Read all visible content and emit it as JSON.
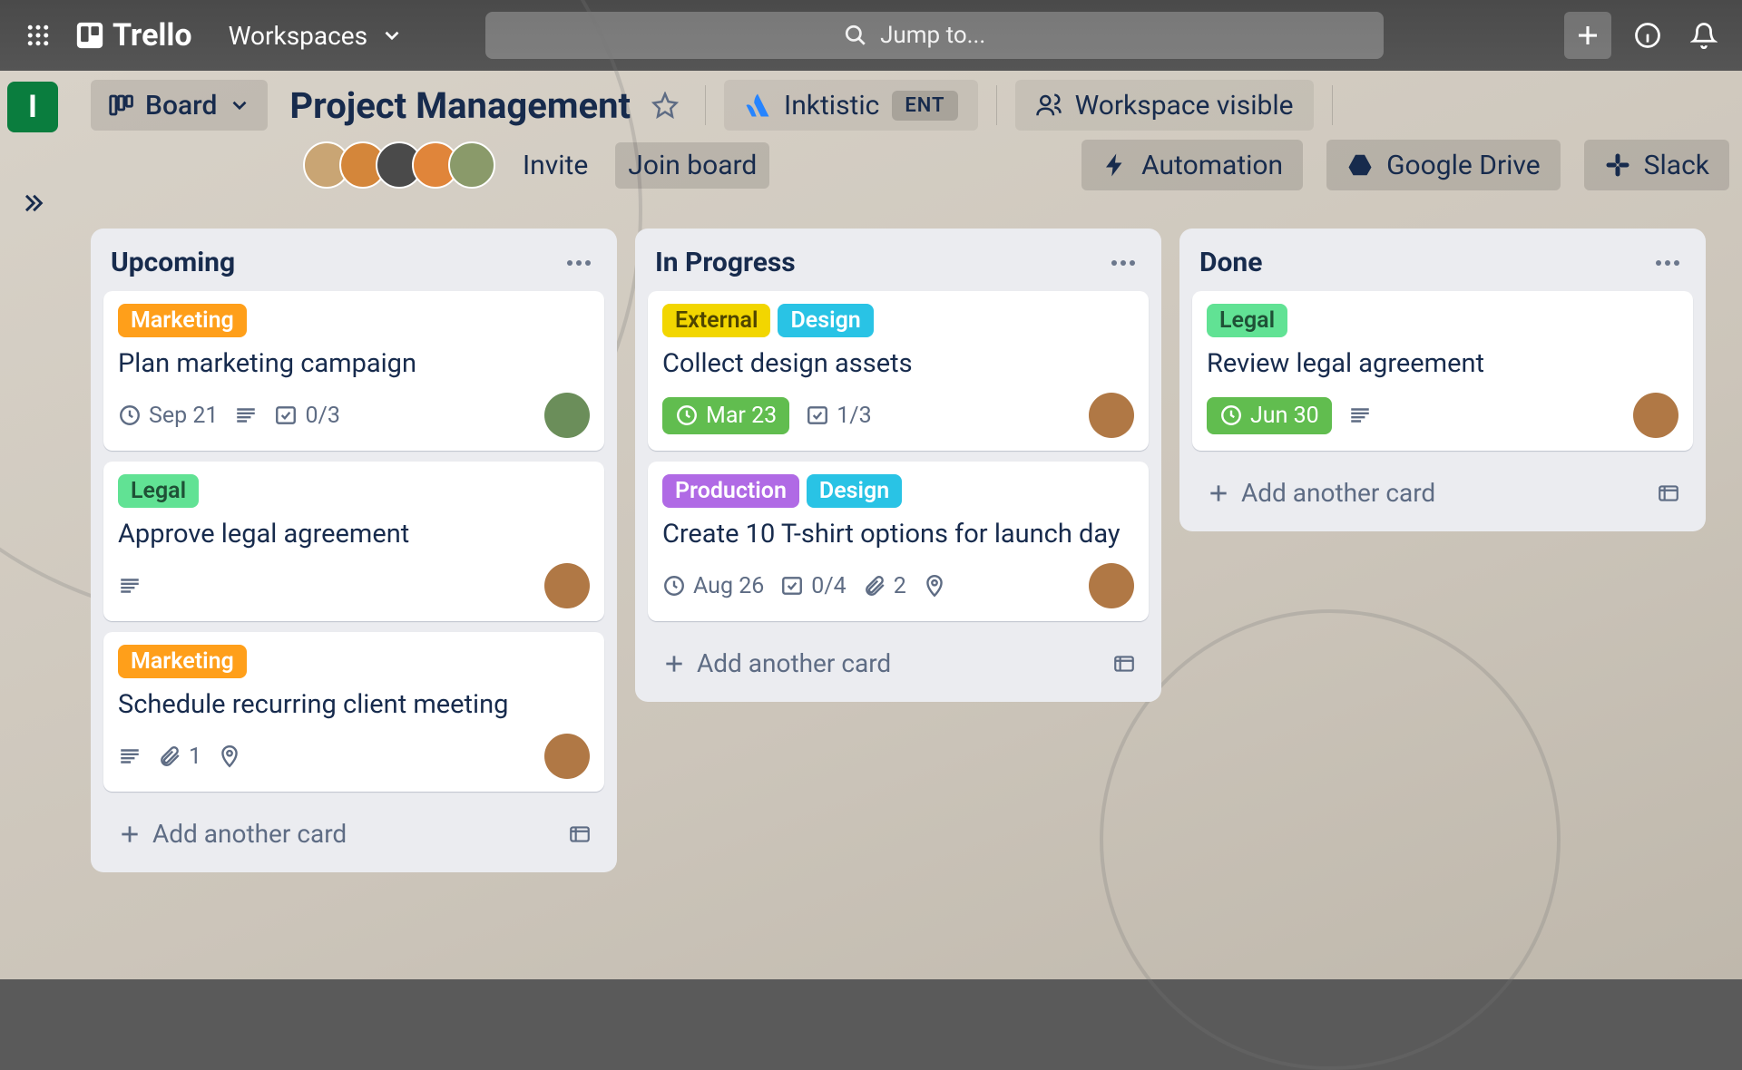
{
  "nav": {
    "brand": "Trello",
    "workspaces": "Workspaces",
    "search_placeholder": "Jump to..."
  },
  "board": {
    "ws_initial": "I",
    "view": "Board",
    "name": "Project Management",
    "org": "Inktistic",
    "org_badge": "ENT",
    "visibility": "Workspace visible",
    "invite": "Invite",
    "join": "Join board",
    "automation": "Automation",
    "gdrive": "Google Drive",
    "slack": "Slack"
  },
  "labels": {
    "marketing": "Marketing",
    "legal": "Legal",
    "external": "External",
    "design": "Design",
    "production": "Production"
  },
  "lists": [
    {
      "title": "Upcoming",
      "add": "Add another card",
      "cards": [
        {
          "labels": [
            "marketing"
          ],
          "title": "Plan marketing campaign",
          "due": "Sep 21",
          "due_color": "",
          "desc": true,
          "check": "0/3",
          "attach": "",
          "loc": false,
          "avatar": "#6b8e5a"
        },
        {
          "labels": [
            "legal"
          ],
          "title": "Approve legal agreement",
          "due": "",
          "due_color": "",
          "desc": true,
          "check": "",
          "attach": "",
          "loc": false,
          "avatar": "#b07845"
        },
        {
          "labels": [
            "marketing"
          ],
          "title": "Schedule recurring client meeting",
          "due": "",
          "due_color": "",
          "desc": true,
          "check": "",
          "attach": "1",
          "loc": true,
          "avatar": "#b07845"
        }
      ]
    },
    {
      "title": "In Progress",
      "add": "Add another card",
      "cards": [
        {
          "labels": [
            "external",
            "design"
          ],
          "title": "Collect design assets",
          "due": "Mar 23",
          "due_color": "g",
          "desc": false,
          "check": "1/3",
          "attach": "",
          "loc": false,
          "avatar": "#b07845"
        },
        {
          "labels": [
            "production",
            "design"
          ],
          "title": "Create 10 T-shirt options for launch day",
          "due": "Aug 26",
          "due_color": "",
          "desc": false,
          "check": "0/4",
          "attach": "2",
          "loc": true,
          "avatar": "#b07845"
        }
      ]
    },
    {
      "title": "Done",
      "add": "Add another card",
      "cards": [
        {
          "labels": [
            "legal"
          ],
          "title": "Review legal agreement",
          "due": "Jun 30",
          "due_color": "g",
          "desc": true,
          "check": "",
          "attach": "",
          "loc": false,
          "avatar": "#b07845"
        }
      ]
    }
  ]
}
